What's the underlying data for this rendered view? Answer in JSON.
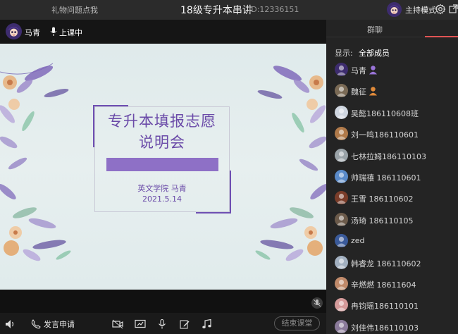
{
  "topbar": {
    "gift_link": "礼物问题点我",
    "course_title": "18级专升本串讲",
    "course_id": "ID:12336151",
    "host_mode": "主持模式"
  },
  "stage": {
    "teacher_name": "马青",
    "live_status": "上课中"
  },
  "slide": {
    "title_line1": "专升本填报志愿",
    "title_line2": "说明会",
    "author": "英文学院  马青",
    "date": "2021.5.14"
  },
  "toolbar": {
    "speak_request": "发言申请",
    "end_class": "结束课堂"
  },
  "panel": {
    "tab_group": "群聊",
    "show_label": "显示:",
    "show_value": "全部成员",
    "members": [
      {
        "name": "马青",
        "badge": "teacher-badge-icon"
      },
      {
        "name": "魏征",
        "badge": "assistant-badge-icon"
      },
      {
        "name": "吴懿186110608班"
      },
      {
        "name": "刘一鸣186110601"
      },
      {
        "name": "七林拉姆186110103"
      },
      {
        "name": "帅瑞禧 186110601"
      },
      {
        "name": "王雪 186110602"
      },
      {
        "name": "汤琦 186110105"
      },
      {
        "name": "zed"
      },
      {
        "name": "韩睿龙 186110602"
      },
      {
        "name": "辛燃燃 18611604"
      },
      {
        "name": "冉钧瑶186110101"
      },
      {
        "name": "刘佳伟186110103"
      }
    ]
  },
  "colors": {
    "accent": "#e05454",
    "slide_purple": "#6a4aa8",
    "slide_bar": "#8e70c6"
  }
}
